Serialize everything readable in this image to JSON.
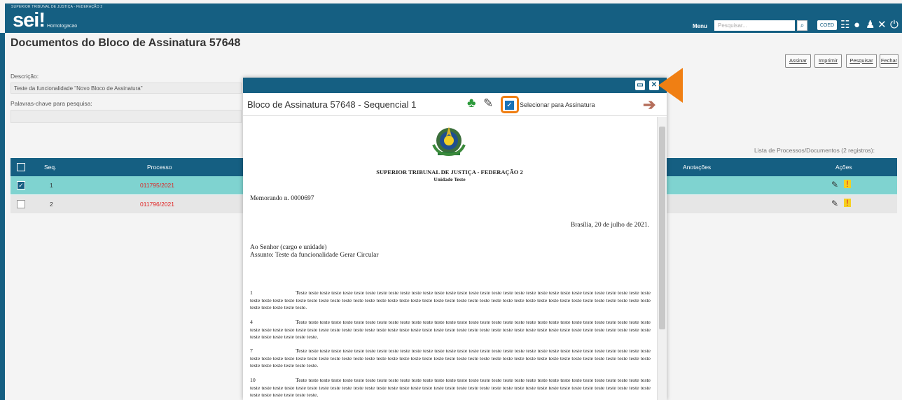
{
  "header": {
    "org": "SUPERIOR TRIBUNAL DE JUSTIÇA - FEDERAÇÃO 2",
    "logo": "sei!",
    "env": "Homologacao",
    "menu_label": "Menu",
    "search_placeholder": "Pesquisar...",
    "unit": "COED"
  },
  "page": {
    "title": "Documentos do Bloco de Assinatura 57648",
    "buttons": [
      "Assinar",
      "Imprimir",
      "Pesquisar",
      "Fechar"
    ],
    "descricao_label": "Descrição:",
    "descricao_value": "Teste da funcionalidade \"Novo Bloco de Assinatura\"",
    "palavras_label": "Palavras-chave para pesquisa:",
    "palavras_value": "",
    "count": "Lista de Processos/Documentos (2 registros):"
  },
  "table": {
    "headers": {
      "seq": "Seq.",
      "processo": "Processo",
      "anotacoes": "Anotações",
      "acoes": "Ações"
    },
    "rows": [
      {
        "seq": "1",
        "processo": "011795/2021",
        "checked": true
      },
      {
        "seq": "2",
        "processo": "011796/2021",
        "checked": false
      }
    ]
  },
  "modal": {
    "title": "Bloco de Assinatura 57648 - Sequencial 1",
    "select_label": "Selecionar para Assinatura"
  },
  "document": {
    "court": "SUPERIOR TRIBUNAL DE JUSTIÇA - FEDERAÇÃO 2",
    "unit": "Unidade Teste",
    "memo": "Memorando n. 0000697",
    "date": "Brasília, 20 de julho de 2021.",
    "to": "Ao Senhor (cargo e unidade)",
    "subject": "Assunto: Teste da funcionalidade Gerar Circular",
    "paragraphs": [
      {
        "num": "1",
        "text": "Teste teste teste teste teste teste teste teste teste teste teste teste teste teste teste teste teste teste teste teste teste teste teste teste teste teste teste teste teste teste teste teste teste teste teste teste teste teste teste teste teste teste teste teste teste teste teste teste teste teste teste teste teste teste teste teste teste teste teste teste teste teste teste teste teste teste teste teste teste teste teste."
      },
      {
        "num": "4",
        "text": "Teste teste teste teste teste teste teste teste teste teste teste teste teste teste teste teste teste teste teste teste teste teste teste teste teste teste teste teste teste teste teste teste teste teste teste teste teste teste teste teste teste teste teste teste teste teste teste teste teste teste teste teste teste teste teste teste teste teste teste teste teste teste teste teste teste teste teste teste teste teste teste teste."
      },
      {
        "num": "7",
        "text": "Teste teste teste teste teste teste teste teste teste teste teste teste teste teste teste teste teste teste teste teste teste teste teste teste teste teste teste teste teste teste teste teste teste teste teste teste teste teste teste teste teste teste teste teste teste teste teste teste teste teste teste teste teste teste teste teste teste teste teste teste teste teste teste teste teste teste teste teste teste teste teste teste."
      },
      {
        "num": "10",
        "text": "Teste teste teste teste teste teste teste teste teste teste teste teste teste teste teste teste teste teste teste teste teste teste teste teste teste teste teste teste teste teste teste teste teste teste teste teste teste teste teste teste teste teste teste teste teste teste teste teste teste teste teste teste teste teste teste teste teste teste teste teste teste teste teste teste teste teste teste teste teste teste teste teste."
      }
    ]
  },
  "icons": {
    "search": "search-icon",
    "grid": "grid-icon",
    "info": "info-icon",
    "user": "user-icon",
    "tools": "tools-icon",
    "power": "power-icon",
    "tree": "tree-icon",
    "pen": "pen-icon",
    "next": "arrow-right-icon",
    "minimize": "minimize-icon",
    "close": "close-icon",
    "alert": "alert-icon"
  },
  "colors": {
    "brand": "#155f82",
    "highlight": "#f07f13",
    "row_selected": "#7fd3d0",
    "process_link": "#e02424"
  }
}
